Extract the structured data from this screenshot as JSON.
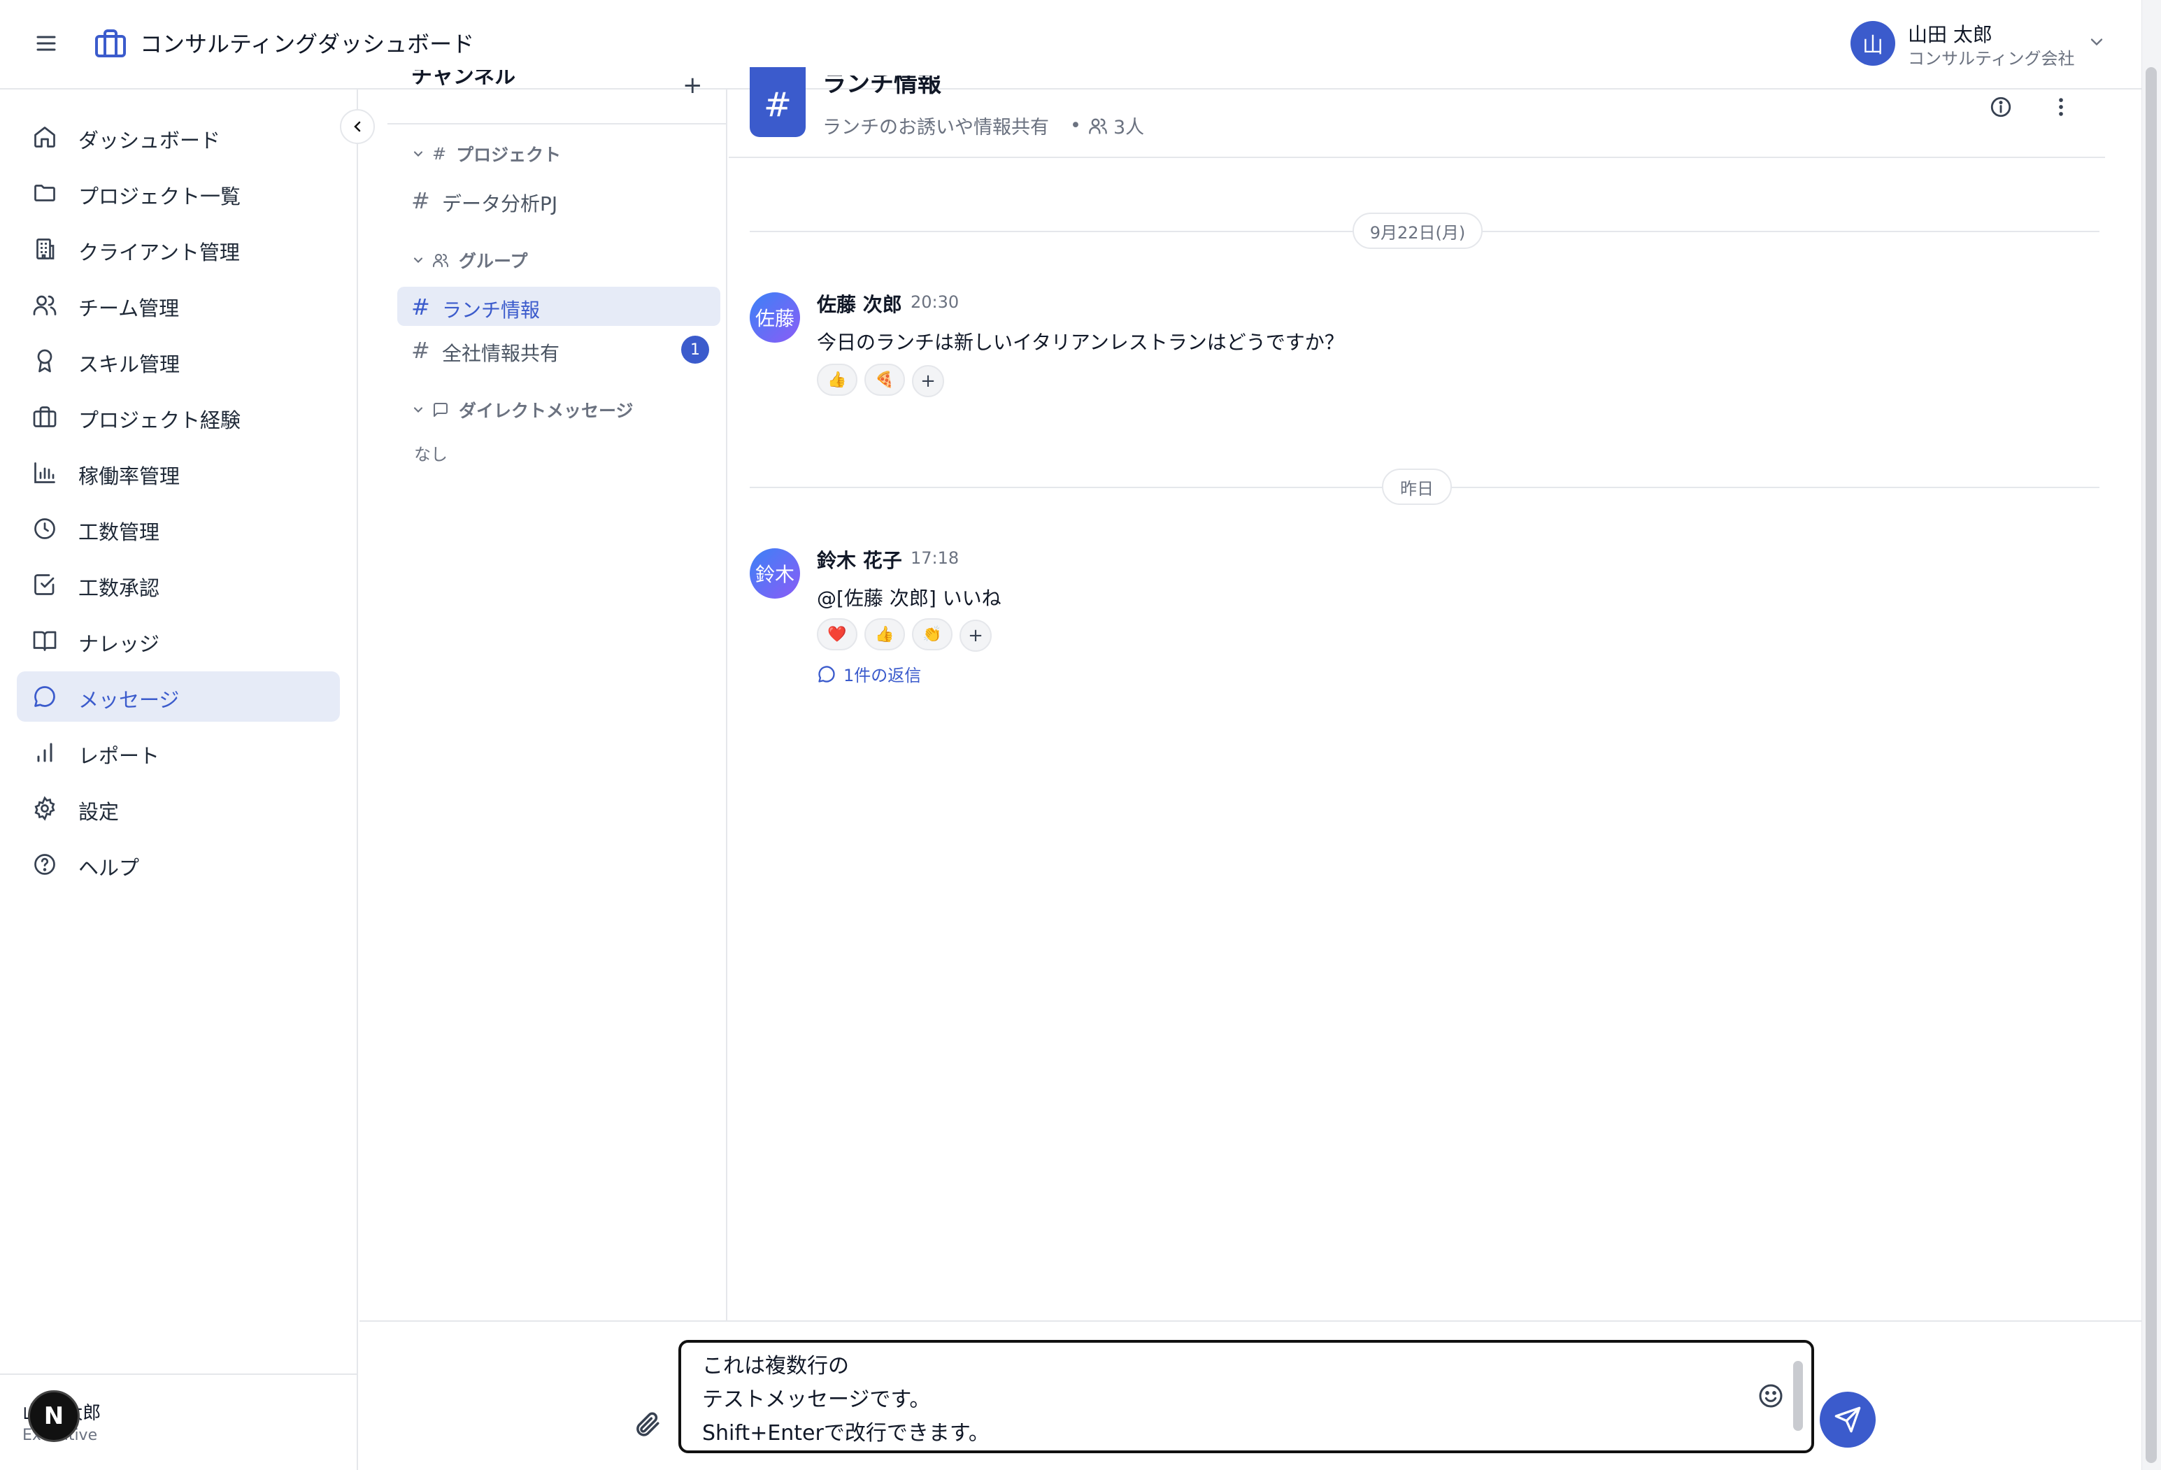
{
  "app": {
    "title": "コンサルティングダッシュボード"
  },
  "user": {
    "avatar": "山",
    "name": "山田 太郎",
    "company": "コンサルティング会社"
  },
  "sidebar": {
    "items": [
      {
        "label": "ダッシュボード",
        "icon": "home-icon"
      },
      {
        "label": "プロジェクト一覧",
        "icon": "folder-icon"
      },
      {
        "label": "クライアント管理",
        "icon": "building-icon"
      },
      {
        "label": "チーム管理",
        "icon": "users-icon"
      },
      {
        "label": "スキル管理",
        "icon": "award-icon"
      },
      {
        "label": "プロジェクト経験",
        "icon": "briefcase-icon"
      },
      {
        "label": "稼働率管理",
        "icon": "bar-chart-icon"
      },
      {
        "label": "工数管理",
        "icon": "clock-icon"
      },
      {
        "label": "工数承認",
        "icon": "check-square-icon"
      },
      {
        "label": "ナレッジ",
        "icon": "book-icon"
      },
      {
        "label": "メッセージ",
        "icon": "message-icon",
        "active": true
      },
      {
        "label": "レポート",
        "icon": "bar-chart-2-icon"
      },
      {
        "label": "設定",
        "icon": "settings-icon"
      },
      {
        "label": "ヘルプ",
        "icon": "help-icon"
      }
    ],
    "footer": {
      "name": "山田 太郎",
      "role": "Executive",
      "badge": "N"
    }
  },
  "channels": {
    "header": "チャンネル",
    "add": "+",
    "sections": {
      "project": "プロジェクト",
      "group": "グループ",
      "dm": "ダイレクトメッセージ"
    },
    "items": {
      "data_pj": "データ分析PJ",
      "lunch": "ランチ情報",
      "company": "全社情報共有",
      "company_unread": "1"
    },
    "dm_empty": "なし"
  },
  "room": {
    "hash": "#",
    "title": "ランチ情報",
    "description": "ランチのお誘いや情報共有",
    "members": "3人"
  },
  "messages": {
    "date1": "9月22日(月)",
    "date2": "昨日",
    "m1": {
      "avatar": "佐藤",
      "name": "佐藤 次郎",
      "time": "20:30",
      "text": "今日のランチは新しいイタリアンレストランはどうですか？",
      "reactions": [
        "👍",
        "🍕"
      ]
    },
    "m2": {
      "avatar": "鈴木",
      "name": "鈴木 花子",
      "time": "17:18",
      "text": "@[佐藤 次郎]  いいね",
      "reactions": [
        "❤️",
        "👍",
        "👏"
      ],
      "replies": "1件の返信"
    },
    "react_add": "+"
  },
  "composer": {
    "value": "これは複数行の\nテストメッセージです。\nShift+Enterで改行できます。"
  },
  "colors": {
    "accent": "#3b5bcc",
    "active_bg": "#e6ebf7",
    "border": "#e5e7eb"
  }
}
